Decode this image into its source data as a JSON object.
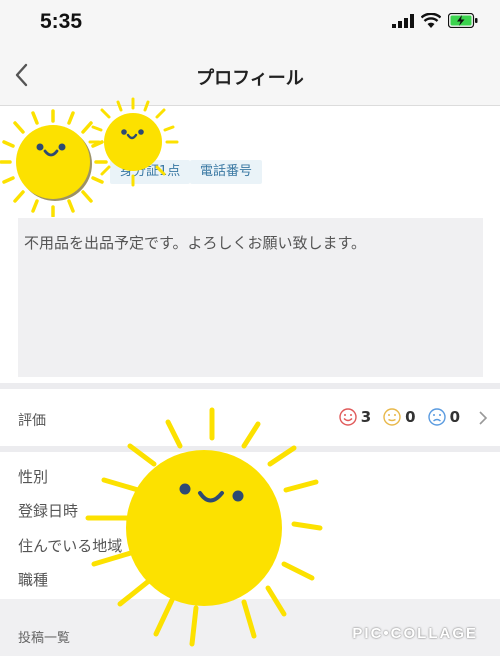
{
  "status": {
    "time": "5:35"
  },
  "nav": {
    "title": "プロフィール"
  },
  "badges": [
    "身分証1点",
    "電話番号"
  ],
  "intro": "不用品を出品予定です。よろしくお願い致します。",
  "rating": {
    "label": "評価",
    "good": "3",
    "normal": "0",
    "bad": "0"
  },
  "info": [
    "性別",
    "登録日時",
    "住んでいる地域",
    "職種"
  ],
  "posts": {
    "title": "投稿一覧"
  },
  "watermark": "PIC•COLLAGE",
  "colors": {
    "good": "#e05a5a",
    "normal": "#e8b84a",
    "bad": "#5a9be0",
    "sun": "#fce100",
    "badge_text": "#3b79a3"
  }
}
